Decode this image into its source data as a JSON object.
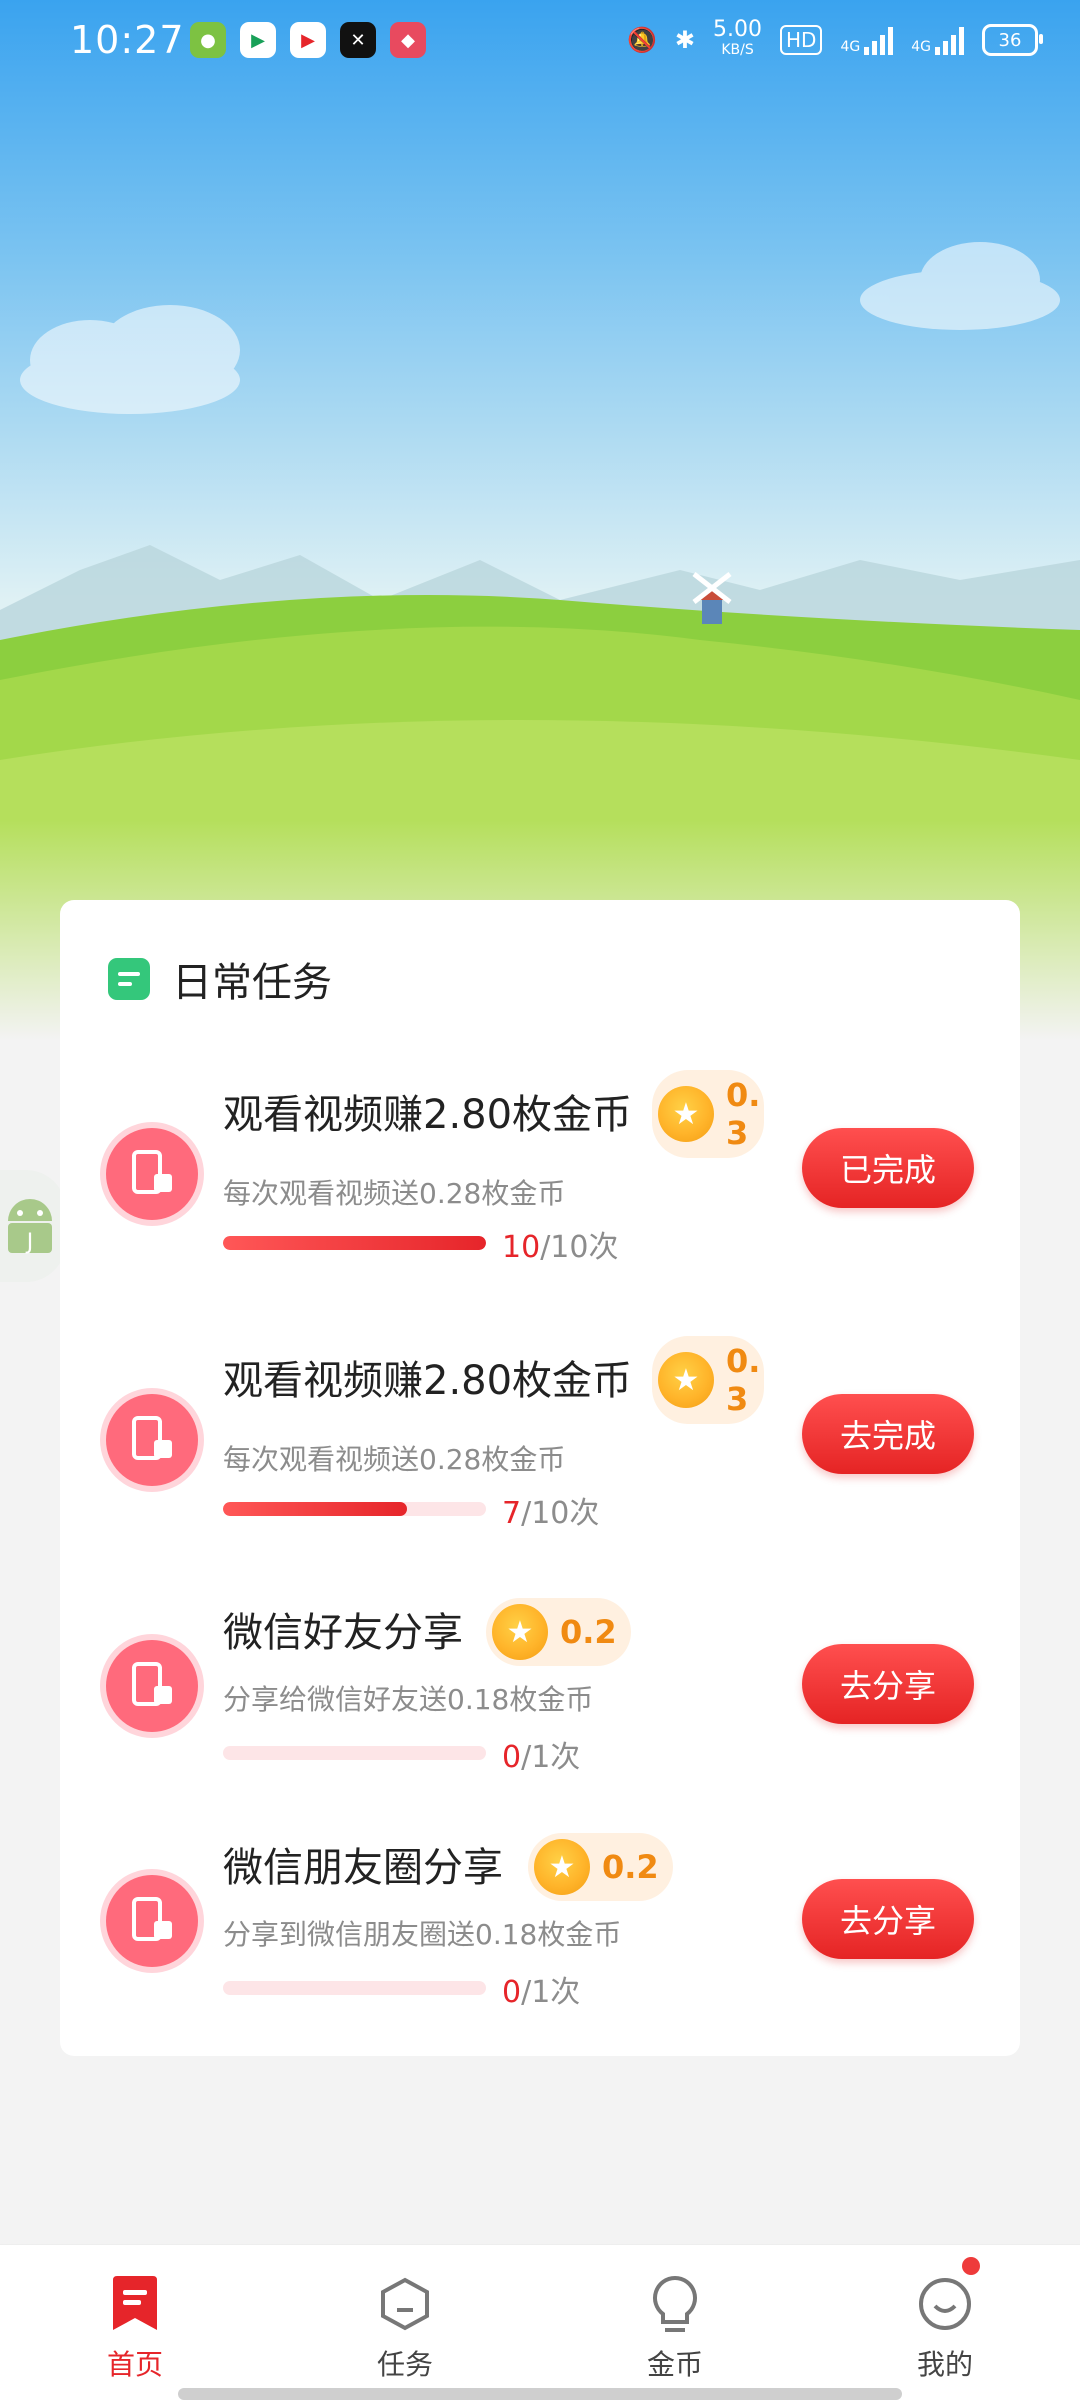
{
  "status_bar": {
    "time": "10:27",
    "net_speed": "5.00",
    "net_unit": "KB/S",
    "hd": "HD",
    "net_type_1": "4G",
    "net_type_2": "4G",
    "battery": "36"
  },
  "daily_tasks": {
    "title": "日常任务",
    "items": [
      {
        "title": "观看视频赚2.80枚金币",
        "reward": "0.3",
        "desc": "每次观看视频送0.28枚金币",
        "progress_done": "10",
        "progress_total": "/10次",
        "progress_fraction": 1.0,
        "button": "已完成"
      },
      {
        "title": "观看视频赚2.80枚金币",
        "reward": "0.3",
        "desc": "每次观看视频送0.28枚金币",
        "progress_done": "7",
        "progress_total": "/10次",
        "progress_fraction": 0.7,
        "button": "去完成"
      },
      {
        "title": "微信好友分享",
        "reward": "0.2",
        "desc": "分享给微信好友送0.18枚金币",
        "progress_done": "0",
        "progress_total": "/1次",
        "progress_fraction": 0.0,
        "button": "去分享"
      },
      {
        "title": "微信朋友圈分享",
        "reward": "0.2",
        "desc": "分享到微信朋友圈送0.18枚金币",
        "progress_done": "0",
        "progress_total": "/1次",
        "progress_fraction": 0.0,
        "button": "去分享"
      }
    ]
  },
  "bottom_nav": {
    "items": [
      {
        "label": "首页",
        "icon": "bookmark-icon",
        "active": true
      },
      {
        "label": "任务",
        "icon": "hexagon-icon",
        "active": false
      },
      {
        "label": "金币",
        "icon": "lightbulb-icon",
        "active": false
      },
      {
        "label": "我的",
        "icon": "smile-icon",
        "active": false,
        "badge": true
      }
    ]
  },
  "colors": {
    "accent": "#e6252a",
    "reward_text": "#f08a12",
    "header_icon": "#34c77b"
  }
}
